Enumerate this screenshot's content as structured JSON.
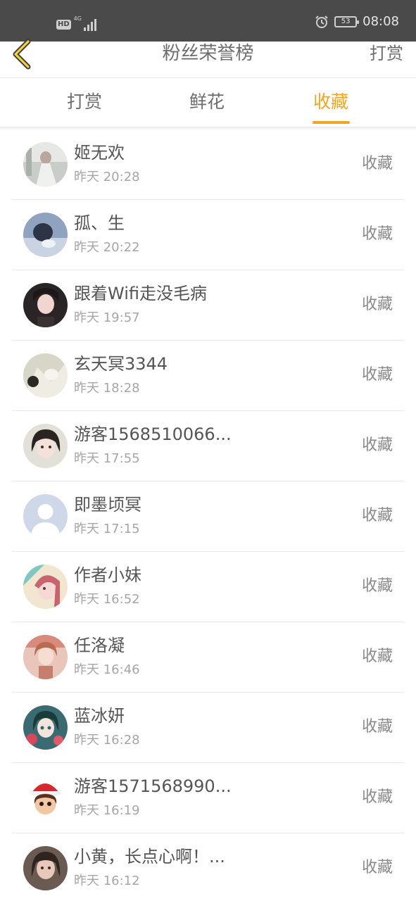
{
  "status_bar": {
    "hd": "HD",
    "network": "4G",
    "battery": "53",
    "time": "08:08"
  },
  "header": {
    "title": "粉丝荣誉榜",
    "action": "打赏"
  },
  "tabs": [
    {
      "label": "打赏",
      "active": false
    },
    {
      "label": "鲜花",
      "active": false
    },
    {
      "label": "收藏",
      "active": true
    }
  ],
  "accent_color": "#f0a621",
  "fans": [
    {
      "name": "姬无欢",
      "time": "昨天 20:28",
      "action": "收藏"
    },
    {
      "name": "孤、生",
      "time": "昨天 20:22",
      "action": "收藏"
    },
    {
      "name": "跟着Wifi走没毛病",
      "time": "昨天 19:57",
      "action": "收藏"
    },
    {
      "name": "玄天冥3344",
      "time": "昨天 18:28",
      "action": "收藏"
    },
    {
      "name": "游客1568510066...",
      "time": "昨天 17:55",
      "action": "收藏"
    },
    {
      "name": "即墨顷冥",
      "time": "昨天 17:15",
      "action": "收藏"
    },
    {
      "name": "作者小妹",
      "time": "昨天 16:52",
      "action": "收藏"
    },
    {
      "name": "任洛凝",
      "time": "昨天 16:46",
      "action": "收藏"
    },
    {
      "name": "蓝冰妍",
      "time": "昨天 16:28",
      "action": "收藏"
    },
    {
      "name": "游客1571568990...",
      "time": "昨天 16:19",
      "action": "收藏"
    },
    {
      "name": "小黄，长点心啊！...",
      "time": "昨天 16:12",
      "action": "收藏"
    }
  ]
}
